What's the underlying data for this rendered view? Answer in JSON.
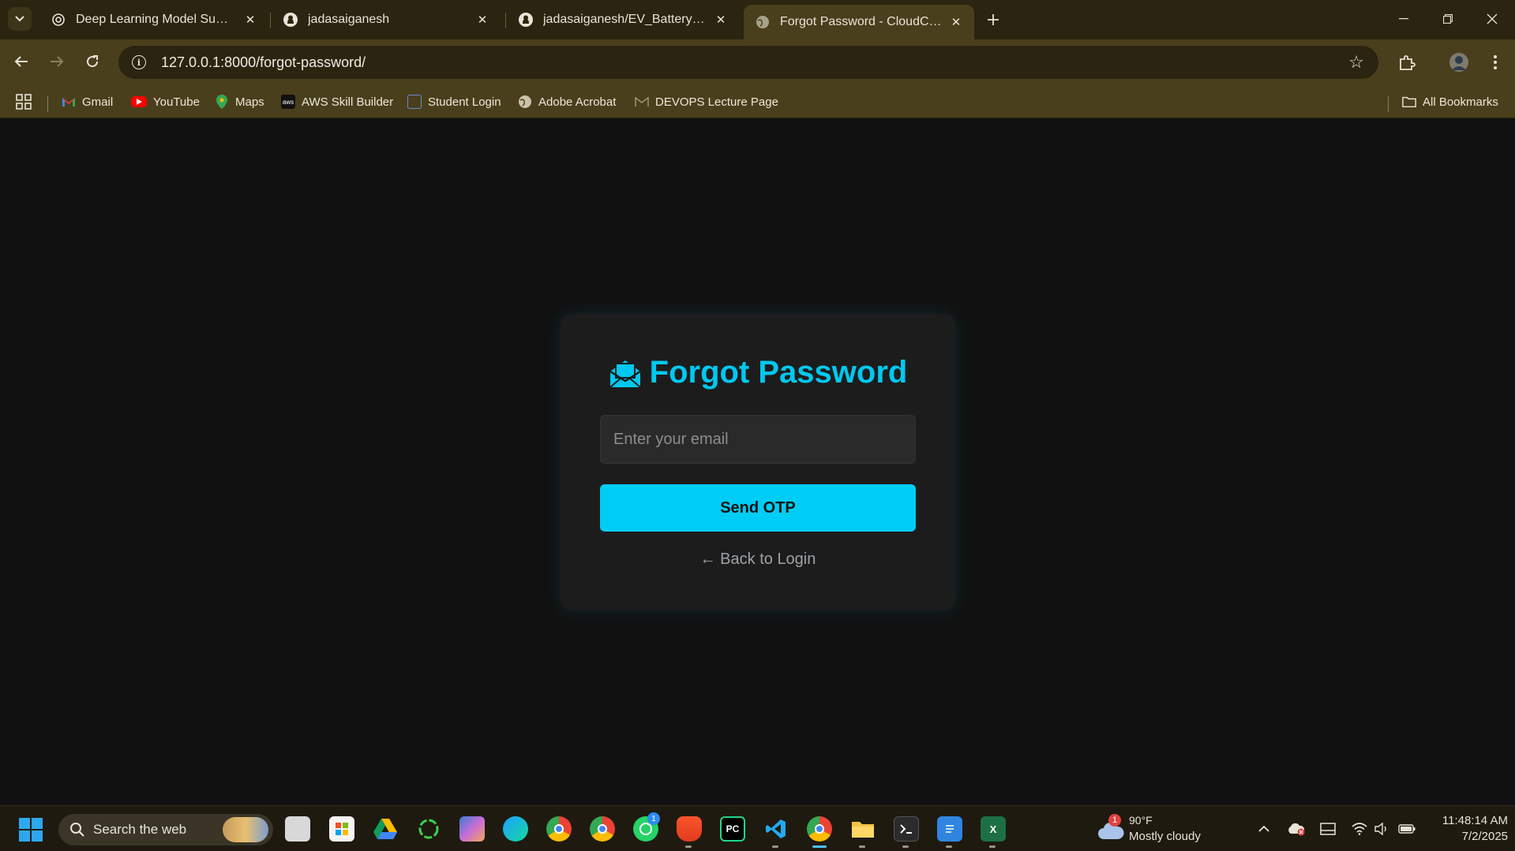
{
  "browser": {
    "tabs": [
      {
        "title": "Deep Learning Model Summary",
        "icon": "openai-icon"
      },
      {
        "title": "jadasaiganesh",
        "icon": "github-icon"
      },
      {
        "title": "jadasaiganesh/EV_Battery_SOH_",
        "icon": "github-icon"
      },
      {
        "title": "Forgot Password - CloudCopilot",
        "icon": "globe-icon",
        "active": true
      }
    ],
    "url": "127.0.0.1:8000/forgot-password/",
    "bookmarks": [
      {
        "label": "Gmail",
        "icon": "gmail-icon"
      },
      {
        "label": "YouTube",
        "icon": "youtube-icon"
      },
      {
        "label": "Maps",
        "icon": "maps-icon"
      },
      {
        "label": "AWS Skill Builder",
        "icon": "aws-icon"
      },
      {
        "label": "Student Login",
        "icon": "student-icon"
      },
      {
        "label": "Adobe Acrobat",
        "icon": "globe-icon"
      },
      {
        "label": "DEVOPS Lecture Page",
        "icon": "gmail-outline-icon"
      }
    ],
    "all_bookmarks_label": "All Bookmarks"
  },
  "page": {
    "title": "Forgot Password",
    "email_placeholder": "Enter your email",
    "send_button": "Send OTP",
    "back_link": "← Back to Login",
    "accent_color": "#00c8f0"
  },
  "taskbar": {
    "search_label": "Search the web",
    "whatsapp_badge": "1",
    "weather_badge": "1",
    "weather_temp": "90°F",
    "weather_cond": "Mostly cloudy",
    "time": "11:48:14 AM",
    "date": "7/2/2025"
  }
}
